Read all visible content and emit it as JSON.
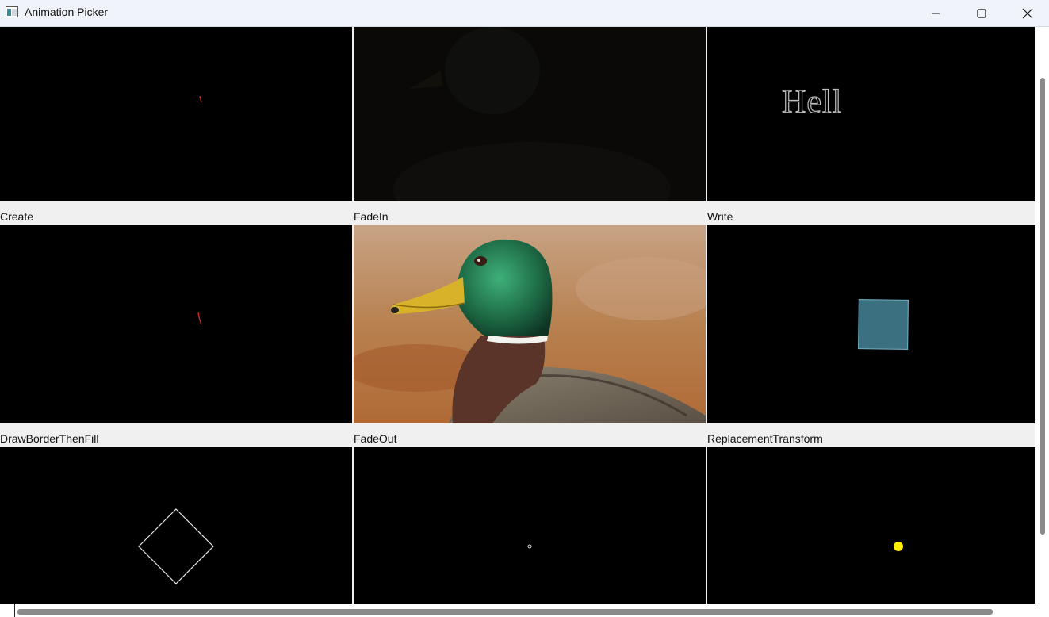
{
  "window": {
    "title": "Animation Picker",
    "icon": "app-window-icon",
    "controls": [
      "minimize-icon",
      "maximize-icon",
      "close-icon"
    ]
  },
  "grid": {
    "items": [
      {
        "label": "Create",
        "preview": "create"
      },
      {
        "label": "FadeIn",
        "preview": "fadein"
      },
      {
        "label": "Write",
        "preview": "write",
        "text": "Hell"
      },
      {
        "label": "DrawBorderThenFill",
        "preview": "drawborderthenfill"
      },
      {
        "label": "FadeOut",
        "preview": "fadeout"
      },
      {
        "label": "ReplacementTransform",
        "preview": "replacementtransform"
      },
      {
        "label": "",
        "preview": "diamond"
      },
      {
        "label": "",
        "preview": "dot"
      },
      {
        "label": "",
        "preview": "yellow-dot"
      }
    ]
  },
  "colors": {
    "preview_bg": "#000000",
    "panel_bg": "#f0f0f0",
    "square_fill": "#3a7080",
    "yellow_dot": "#ffee00",
    "red_stroke": "#d03020"
  }
}
